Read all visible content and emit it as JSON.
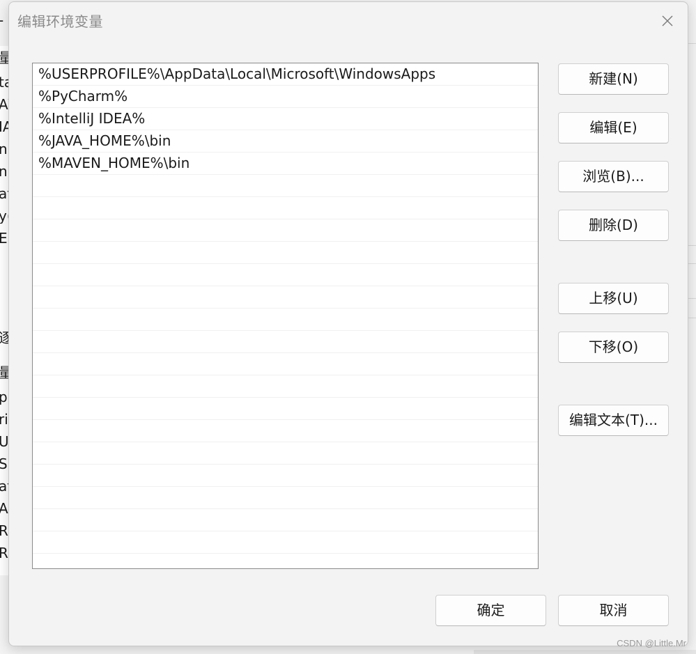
{
  "dialog": {
    "title": "编辑环境变量"
  },
  "path_list": {
    "entries": [
      "%USERPROFILE%\\AppData\\Local\\Microsoft\\WindowsApps",
      "%PyCharm%",
      "%IntelliJ IDEA%",
      "%JAVA_HOME%\\bin",
      "%MAVEN_HOME%\\bin"
    ]
  },
  "buttons": {
    "new": "新建(N)",
    "edit": "编辑(E)",
    "browse": "浏览(B)...",
    "delete": "删除(D)",
    "move_up": "上移(U)",
    "move_down": "下移(O)",
    "edit_text": "编辑文本(T)...",
    "ok": "确定",
    "cancel": "取消"
  },
  "background_window": {
    "fragments": [
      "-",
      "量",
      "ta",
      "A\\",
      "IA",
      "n",
      "n",
      "at",
      "y(",
      "El",
      "逐",
      "量",
      "pr",
      "ri",
      "U",
      "S",
      "at",
      "A",
      "R(",
      "R("
    ]
  },
  "watermark": "CSDN @Little.Mr",
  "colors": {
    "dialog_bg": "#f3f3f3",
    "list_bg": "#ffffff",
    "button_bg": "#fdfdfd",
    "title_text": "#8a8a8a"
  }
}
